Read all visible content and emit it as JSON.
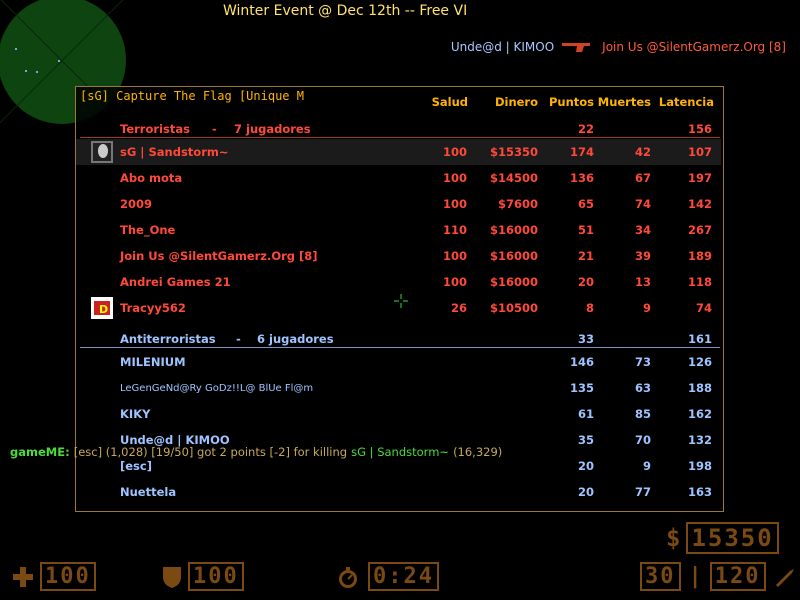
{
  "topbar": {
    "title": "Winter Event @ Dec 12th -- Free VI"
  },
  "killfeed": {
    "killer": "Unde@d | KIMOO",
    "victim": "Join Us @SilentGamerz.Org [8]",
    "weapon_icon": "pistol-icon"
  },
  "scoreboard": {
    "server_name": "[sG] Capture The Flag [Unique M",
    "headers": {
      "health": "Salud",
      "money": "Dinero",
      "score": "Puntos",
      "deaths": "Muertes",
      "latency": "Latencia"
    },
    "terrorists": {
      "label": "Terroristas",
      "sep": "-",
      "count": "7 jugadores",
      "score": "22",
      "latency": "156",
      "players": [
        {
          "name": "sG | Sandstorm~",
          "health": "100",
          "money": "$15350",
          "score": "174",
          "deaths": "42",
          "latency": "107",
          "avatar": true,
          "highlight": true
        },
        {
          "name": "Abo mota",
          "health": "100",
          "money": "$14500",
          "score": "136",
          "deaths": "67",
          "latency": "197"
        },
        {
          "name": "2009",
          "health": "100",
          "money": "$7600",
          "score": "65",
          "deaths": "74",
          "latency": "142"
        },
        {
          "name": "The_One",
          "health": "110",
          "money": "$16000",
          "score": "51",
          "deaths": "34",
          "latency": "267"
        },
        {
          "name": "Join Us @SilentGamerz.Org [8]",
          "health": "100",
          "money": "$16000",
          "score": "21",
          "deaths": "39",
          "latency": "189"
        },
        {
          "name": "Andrei Games 21",
          "health": "100",
          "money": "$16000",
          "score": "20",
          "deaths": "13",
          "latency": "118"
        },
        {
          "name": "Tracyy562",
          "health": "26",
          "money": "$10500",
          "score": "8",
          "deaths": "9",
          "latency": "74",
          "avatar2": true
        }
      ]
    },
    "counter_terrorists": {
      "label": "Antiterroristas",
      "sep": "-",
      "count": "6 jugadores",
      "score": "33",
      "latency": "161",
      "players": [
        {
          "name": "MILENIUM",
          "score": "146",
          "deaths": "73",
          "latency": "126"
        },
        {
          "name": "LeGenGeNd@Ry GoDz!!L@ BlUe Fl@m",
          "score": "135",
          "deaths": "63",
          "latency": "188",
          "small": true
        },
        {
          "name": "KIKY",
          "score": "61",
          "deaths": "85",
          "latency": "162"
        },
        {
          "name": "Unde@d | KIMOO",
          "score": "35",
          "deaths": "70",
          "latency": "132"
        },
        {
          "name": "[esc]",
          "score": "20",
          "deaths": "9",
          "latency": "198"
        },
        {
          "name": "Nuettela",
          "score": "20",
          "deaths": "77",
          "latency": "163"
        }
      ]
    }
  },
  "chat": {
    "source": "gameME:",
    "message": "[esc] (1,028) [19/50] got 2 points [-2] for killing",
    "player": "sG | Sandstorm~",
    "tail": "(16,329)"
  },
  "hud": {
    "health": "100",
    "armor": "100",
    "timer": "0:24",
    "money": "15350",
    "money_symbol": "$",
    "ammo_clip": "30",
    "ammo_reserve": "120",
    "ammo_sep": "|"
  },
  "colors": {
    "terrorist": "#ff4a3a",
    "ct": "#9fc4ff",
    "accent": "#ffb400",
    "hud": "#7b4a12"
  }
}
